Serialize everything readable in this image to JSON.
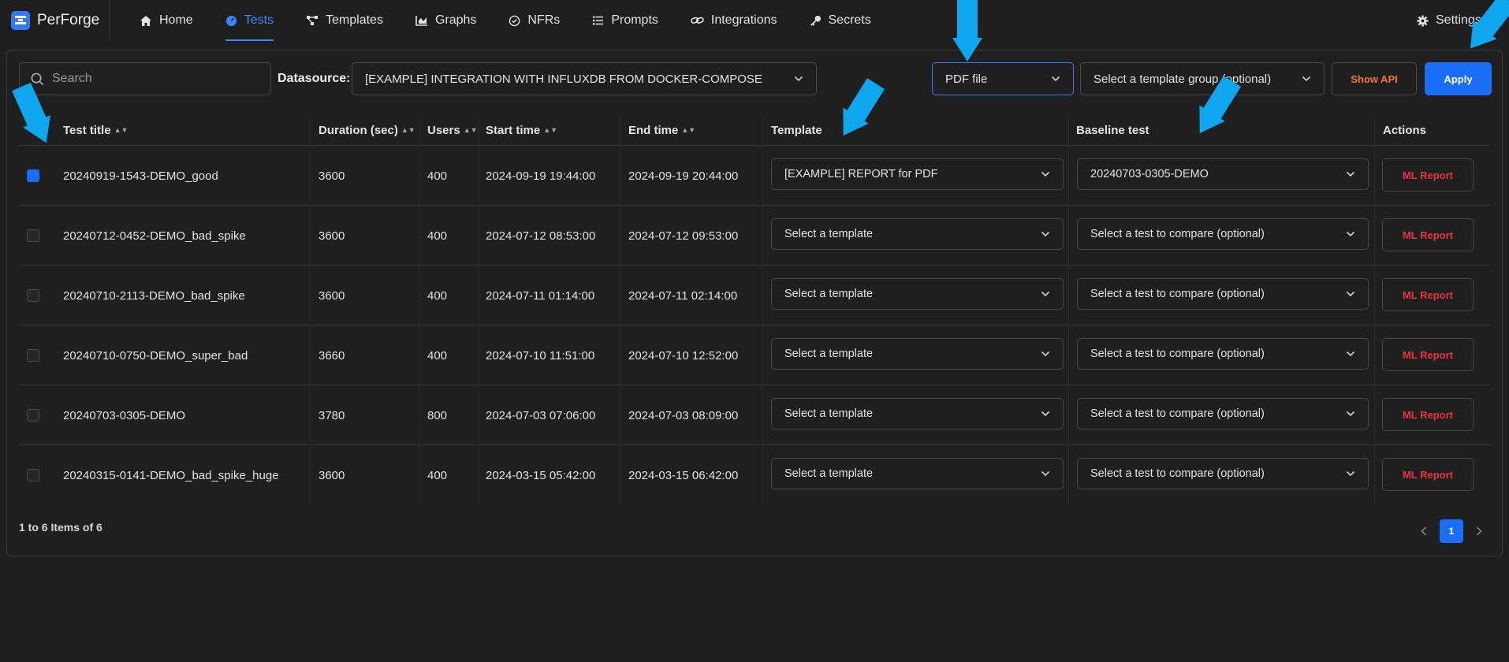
{
  "app": {
    "name": "PerForge"
  },
  "nav": {
    "items": [
      {
        "label": "Home",
        "icon": "home-icon"
      },
      {
        "label": "Tests",
        "icon": "gauge-icon",
        "active": true
      },
      {
        "label": "Templates",
        "icon": "templates-icon"
      },
      {
        "label": "Graphs",
        "icon": "graph-icon"
      },
      {
        "label": "NFRs",
        "icon": "check-circle-icon"
      },
      {
        "label": "Prompts",
        "icon": "list-icon"
      },
      {
        "label": "Integrations",
        "icon": "link-icon"
      },
      {
        "label": "Secrets",
        "icon": "key-icon"
      }
    ],
    "settings": {
      "label": "Settings",
      "icon": "gear-icon"
    }
  },
  "toolbar": {
    "search_placeholder": "Search",
    "datasource_label": "Datasource:",
    "datasource_value": "[EXAMPLE] INTEGRATION WITH INFLUXDB FROM DOCKER-COMPOSE",
    "output_value": "PDF file",
    "template_group_placeholder": "Select a template group (optional)",
    "show_api_label": "Show API",
    "apply_label": "Apply"
  },
  "table": {
    "columns": {
      "title": "Test title",
      "duration": "Duration (sec)",
      "users": "Users",
      "start": "Start time",
      "end": "End time",
      "template": "Template",
      "baseline": "Baseline test",
      "actions": "Actions"
    },
    "rows": [
      {
        "checked": true,
        "title": "20240919-1543-DEMO_good",
        "duration": "3600",
        "users": "400",
        "start": "2024-09-19 19:44:00",
        "end": "2024-09-19 20:44:00",
        "template": "[EXAMPLE] REPORT for PDF",
        "baseline": "20240703-0305-DEMO",
        "action": "ML Report"
      },
      {
        "checked": false,
        "title": "20240712-0452-DEMO_bad_spike",
        "duration": "3600",
        "users": "400",
        "start": "2024-07-12 08:53:00",
        "end": "2024-07-12 09:53:00",
        "template": "Select a template",
        "baseline": "Select a test to compare (optional)",
        "action": "ML Report"
      },
      {
        "checked": false,
        "title": "20240710-2113-DEMO_bad_spike",
        "duration": "3600",
        "users": "400",
        "start": "2024-07-11 01:14:00",
        "end": "2024-07-11 02:14:00",
        "template": "Select a template",
        "baseline": "Select a test to compare (optional)",
        "action": "ML Report"
      },
      {
        "checked": false,
        "title": "20240710-0750-DEMO_super_bad",
        "duration": "3660",
        "users": "400",
        "start": "2024-07-10 11:51:00",
        "end": "2024-07-10 12:52:00",
        "template": "Select a template",
        "baseline": "Select a test to compare (optional)",
        "action": "ML Report"
      },
      {
        "checked": false,
        "title": "20240703-0305-DEMO",
        "duration": "3780",
        "users": "800",
        "start": "2024-07-03 07:06:00",
        "end": "2024-07-03 08:09:00",
        "template": "Select a template",
        "baseline": "Select a test to compare (optional)",
        "action": "ML Report"
      },
      {
        "checked": false,
        "title": "20240315-0141-DEMO_bad_spike_huge",
        "duration": "3600",
        "users": "400",
        "start": "2024-03-15 05:42:00",
        "end": "2024-03-15 06:42:00",
        "template": "Select a template",
        "baseline": "Select a test to compare (optional)",
        "action": "ML Report"
      }
    ]
  },
  "footer": {
    "items_info": "1 to 6 Items of 6",
    "current_page": "1"
  },
  "colors": {
    "accent": "#1a6ef5",
    "annotation_arrow": "#0fa6f0",
    "danger": "#e8343a",
    "warning": "#f07b30",
    "background": "#1e1e1e"
  }
}
